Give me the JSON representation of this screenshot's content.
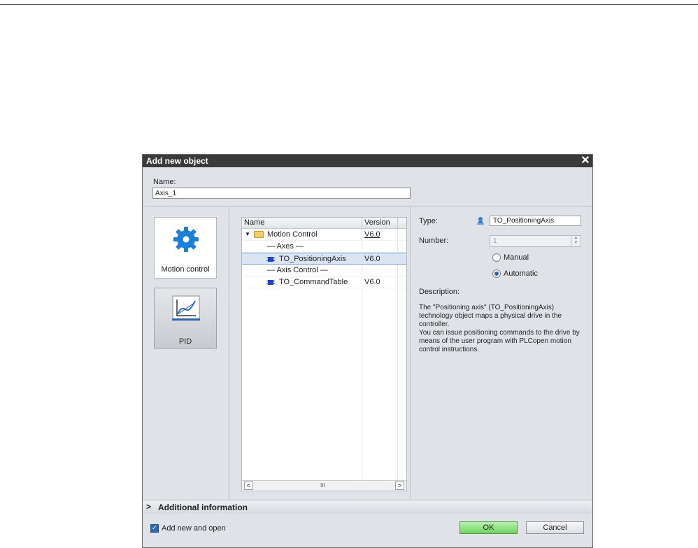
{
  "dialog": {
    "title": "Add new object",
    "close_glyph": "✕",
    "name_label": "Name:",
    "name_value": "Axis_1"
  },
  "categories": [
    {
      "label": "Motion control",
      "icon": "gear-icon",
      "selected": true
    },
    {
      "label": "PID",
      "icon": "pid-chart-icon",
      "selected": false
    }
  ],
  "tree": {
    "headers": {
      "name": "Name",
      "version": "Version"
    },
    "rows": [
      {
        "name": "Motion Control",
        "version": "V6.0",
        "type": "folder",
        "expanded": true
      },
      {
        "name": "— Axes —",
        "version": "",
        "type": "separator"
      },
      {
        "name": "TO_PositioningAxis",
        "version": "V6.0",
        "type": "object",
        "selected": true
      },
      {
        "name": "— Axis Control —",
        "version": "",
        "type": "separator"
      },
      {
        "name": "TO_CommandTable",
        "version": "V6.0",
        "type": "object"
      }
    ],
    "scroll_left": "<",
    "scroll_right": ">",
    "scroll_thumb": "III"
  },
  "properties": {
    "type_label": "Type:",
    "type_value": "TO_PositioningAxis",
    "number_label": "Number:",
    "number_value": "1",
    "radio_manual": "Manual",
    "radio_automatic": "Automatic",
    "selected_mode": "Automatic",
    "description_label": "Description:",
    "description_text": "The \"Positioning axis\" (TO_PositioningAxis) technology object maps a physical drive in the controller.\nYou can issue positioning commands to the drive by means of the user program with PLCopen motion control instructions."
  },
  "additional": {
    "chevron": ">",
    "label": "Additional  information"
  },
  "footer": {
    "add_new_and_open_label": "Add new and open",
    "add_new_and_open_checked": true,
    "ok_label": "OK",
    "cancel_label": "Cancel"
  },
  "colors": {
    "ok_button": "#6fd45e",
    "link": "#1f3fd0",
    "selection": "#dbe5f1",
    "title_bar": "#3a3a3a"
  }
}
